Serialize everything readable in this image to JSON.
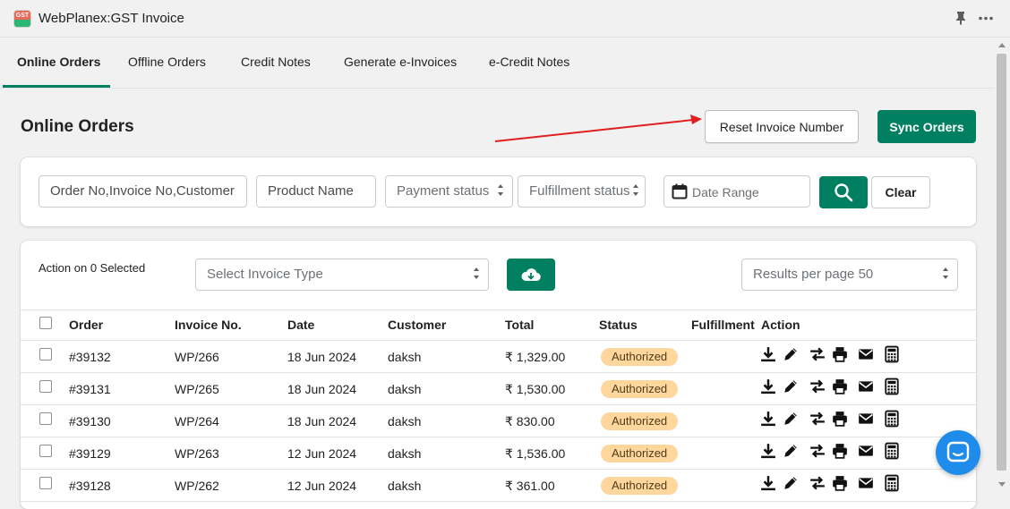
{
  "app": {
    "logo_text": "GST",
    "title": "WebPlanex:GST Invoice"
  },
  "tabs": [
    {
      "label": "Online Orders",
      "active": true
    },
    {
      "label": "Offline Orders",
      "active": false
    },
    {
      "label": "Credit Notes",
      "active": false
    },
    {
      "label": "Generate e-Invoices",
      "active": false
    },
    {
      "label": "e-Credit Notes",
      "active": false
    }
  ],
  "page": {
    "title": "Online Orders",
    "reset_button": "Reset Invoice Number",
    "sync_button": "Sync Orders"
  },
  "filters": {
    "order_search_placeholder": "Order No,Invoice No,Customer",
    "product_placeholder": "Product Name",
    "payment_status": "Payment status",
    "fulfillment_status": "Fulfillment status",
    "date_range_placeholder": "Date Range",
    "clear_button": "Clear"
  },
  "table_toolbar": {
    "action_label": "Action on 0 Selected",
    "invoice_type_placeholder": "Select Invoice Type",
    "results_per_page": "Results per page 50"
  },
  "table": {
    "headers": [
      "Order",
      "Invoice No.",
      "Date",
      "Customer",
      "Total",
      "Status",
      "Fulfillment",
      "Action"
    ],
    "rows": [
      {
        "order": "#39132",
        "invoice": "WP/266",
        "date": "18 Jun 2024",
        "customer": "daksh",
        "total": "₹ 1,329.00",
        "status": "Authorized"
      },
      {
        "order": "#39131",
        "invoice": "WP/265",
        "date": "18 Jun 2024",
        "customer": "daksh",
        "total": "₹ 1,530.00",
        "status": "Authorized"
      },
      {
        "order": "#39130",
        "invoice": "WP/264",
        "date": "18 Jun 2024",
        "customer": "daksh",
        "total": "₹ 830.00",
        "status": "Authorized"
      },
      {
        "order": "#39129",
        "invoice": "WP/263",
        "date": "12 Jun 2024",
        "customer": "daksh",
        "total": "₹ 1,536.00",
        "status": "Authorized"
      },
      {
        "order": "#39128",
        "invoice": "WP/262",
        "date": "12 Jun 2024",
        "customer": "daksh",
        "total": "₹ 361.00",
        "status": "Authorized"
      }
    ]
  },
  "icons": {
    "row_actions": [
      "download-icon",
      "edit-icon",
      "transfer-icon",
      "print-icon",
      "email-icon",
      "calculator-icon"
    ]
  },
  "colors": {
    "primary": "#008060",
    "badge_bg": "#ffd79d",
    "annotation_arrow": "#e02020",
    "chat": "#1f8ceb"
  }
}
